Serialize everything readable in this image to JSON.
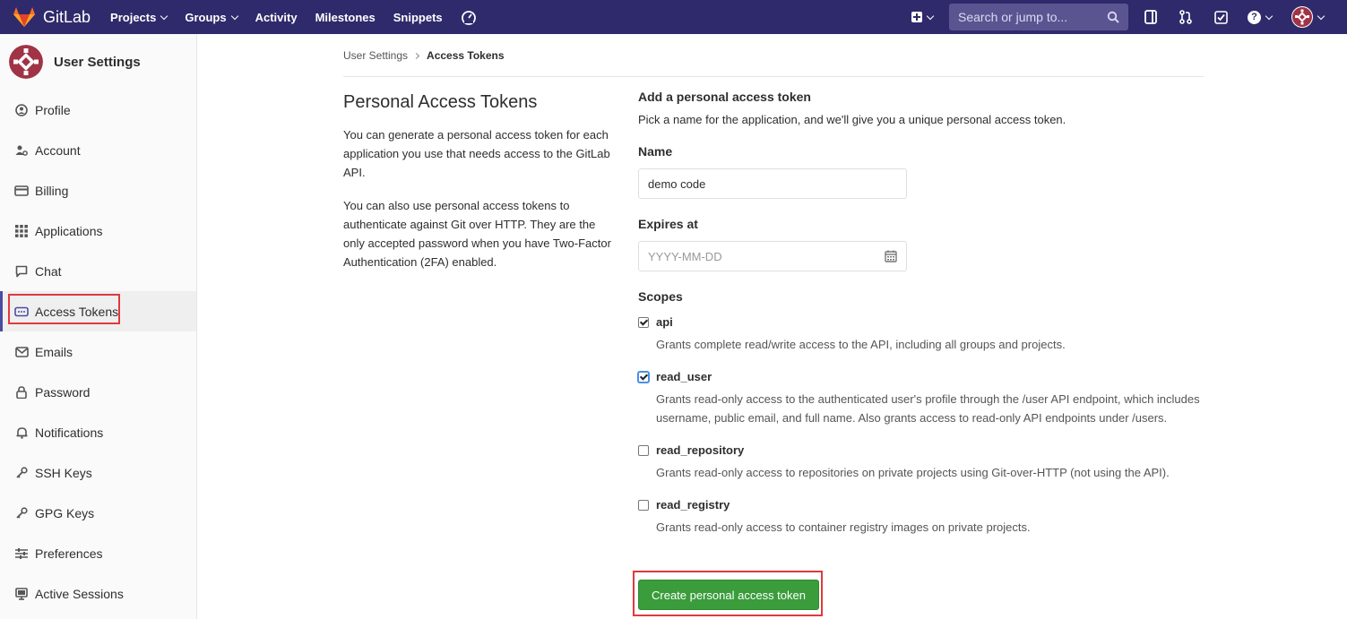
{
  "topbar": {
    "brand": "GitLab",
    "nav": [
      {
        "label": "Projects",
        "dropdown": true
      },
      {
        "label": "Groups",
        "dropdown": true
      },
      {
        "label": "Activity",
        "dropdown": false
      },
      {
        "label": "Milestones",
        "dropdown": false
      },
      {
        "label": "Snippets",
        "dropdown": false
      }
    ],
    "search_placeholder": "Search or jump to...",
    "help_glyph": "?",
    "colors": {
      "bar": "#2f2a6b",
      "search": "#5a5591"
    }
  },
  "sidebar": {
    "title": "User Settings",
    "items": [
      {
        "label": "Profile",
        "icon": "profile-icon"
      },
      {
        "label": "Account",
        "icon": "account-icon"
      },
      {
        "label": "Billing",
        "icon": "credit-card-icon"
      },
      {
        "label": "Applications",
        "icon": "applications-grid-icon"
      },
      {
        "label": "Chat",
        "icon": "chat-icon"
      },
      {
        "label": "Access Tokens",
        "icon": "token-icon",
        "active": true
      },
      {
        "label": "Emails",
        "icon": "envelope-icon"
      },
      {
        "label": "Password",
        "icon": "lock-icon"
      },
      {
        "label": "Notifications",
        "icon": "bell-icon"
      },
      {
        "label": "SSH Keys",
        "icon": "key-icon"
      },
      {
        "label": "GPG Keys",
        "icon": "key-icon"
      },
      {
        "label": "Preferences",
        "icon": "preferences-icon"
      },
      {
        "label": "Active Sessions",
        "icon": "monitor-icon"
      }
    ]
  },
  "breadcrumb": {
    "parent": "User Settings",
    "current": "Access Tokens"
  },
  "intro": {
    "title": "Personal Access Tokens",
    "p1": "You can generate a personal access token for each application you use that needs access to the GitLab API.",
    "p2": "You can also use personal access tokens to authenticate against Git over HTTP. They are the only accepted password when you have Two-Factor Authentication (2FA) enabled."
  },
  "form": {
    "title": "Add a personal access token",
    "subtitle": "Pick a name for the application, and we'll give you a unique personal access token.",
    "name_label": "Name",
    "name_value": "demo code",
    "expires_label": "Expires at",
    "expires_placeholder": "YYYY-MM-DD",
    "scopes_label": "Scopes",
    "scopes": [
      {
        "name": "api",
        "checked": true,
        "desc": "Grants complete read/write access to the API, including all groups and projects."
      },
      {
        "name": "read_user",
        "checked": true,
        "desc": "Grants read-only access to the authenticated user's profile through the /user API endpoint, which includes username, public email, and full name. Also grants access to read-only API endpoints under /users."
      },
      {
        "name": "read_repository",
        "checked": false,
        "desc": "Grants read-only access to repositories on private projects using Git-over-HTTP (not using the API)."
      },
      {
        "name": "read_registry",
        "checked": false,
        "desc": "Grants read-only access to container registry images on private projects."
      }
    ],
    "submit_label": "Create personal access token",
    "submit_color": "#3a9c3b"
  },
  "annotation_color": "#e0393e"
}
